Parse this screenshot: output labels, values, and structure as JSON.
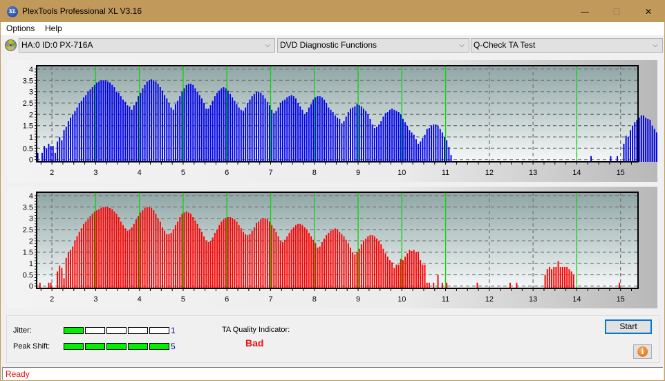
{
  "window": {
    "title": "PlexTools Professional XL V3.16",
    "app_icon_text": "XL"
  },
  "menu": {
    "items": [
      {
        "label": "Options"
      },
      {
        "label": "Help"
      }
    ]
  },
  "toolbar": {
    "drive_select": "HA:0 ID:0  PX-716A",
    "function_select": "DVD Diagnostic Functions",
    "test_select": "Q-Check TA Test"
  },
  "icons": {
    "minimize": "—",
    "maximize": "☐",
    "close": "✕",
    "chevron": "⌵",
    "info": "i"
  },
  "colors": {
    "title_bar": "#c19a5b",
    "top_series": "#0000ee",
    "bottom_series": "#ff0000",
    "marker_lines": "#00dd00",
    "meter_on": "#00ee00",
    "bad": "#ee1111",
    "meter_value": "#0000a0"
  },
  "chart_data": [
    {
      "type": "bar",
      "name": "inner-tracks",
      "title": "",
      "xlabel": "",
      "ylabel": "",
      "xlim": [
        1.65,
        15.4
      ],
      "ylim": [
        -0.1,
        4.15
      ],
      "x_ticks": [
        2,
        3,
        4,
        5,
        6,
        7,
        8,
        9,
        10,
        11,
        12,
        13,
        14,
        15
      ],
      "y_ticks": [
        0,
        0.5,
        1,
        1.5,
        2,
        2.5,
        3,
        3.5,
        4
      ],
      "y_tick_labels": [
        "0",
        "0.5",
        "1",
        "1.5",
        "2",
        "2.5",
        "3",
        "3.5",
        "4"
      ],
      "marker_lines_x": [
        3,
        4,
        5,
        6,
        7,
        8,
        9,
        10,
        11,
        14
      ],
      "grid": true,
      "bar_step": 0.05,
      "series": [
        {
          "name": "distribution",
          "color": "#0000ee",
          "start_x": 1.66,
          "values": [
            0.3,
            0,
            0.3,
            0.6,
            0.5,
            0.7,
            0.6,
            0.6,
            0.3,
            0.8,
            1.0,
            0.85,
            1.3,
            1.45,
            1.7,
            1.85,
            2.0,
            2.15,
            2.3,
            2.5,
            2.6,
            2.75,
            2.85,
            3.0,
            3.1,
            3.2,
            3.3,
            3.4,
            3.45,
            3.5,
            3.5,
            3.5,
            3.45,
            3.4,
            3.3,
            3.2,
            3.0,
            2.95,
            2.8,
            2.65,
            2.55,
            2.4,
            2.35,
            2.2,
            2.4,
            2.55,
            2.8,
            2.95,
            3.15,
            3.3,
            3.45,
            3.5,
            3.55,
            3.5,
            3.45,
            3.35,
            3.2,
            3.05,
            2.85,
            2.7,
            2.5,
            2.3,
            2.2,
            2.45,
            2.6,
            2.8,
            3.0,
            3.15,
            3.3,
            3.35,
            3.35,
            3.3,
            3.15,
            3.0,
            2.85,
            2.7,
            2.5,
            2.25,
            2.25,
            2.4,
            2.6,
            2.8,
            2.95,
            3.05,
            3.15,
            3.2,
            3.15,
            3.05,
            2.9,
            2.75,
            2.6,
            2.45,
            2.3,
            2.2,
            2.15,
            2.3,
            2.5,
            2.65,
            2.8,
            2.9,
            3.0,
            3.0,
            2.95,
            2.85,
            2.7,
            2.55,
            2.4,
            2.2,
            2.05,
            2.15,
            2.3,
            2.5,
            2.6,
            2.65,
            2.75,
            2.8,
            2.85,
            2.8,
            2.7,
            2.5,
            2.35,
            2.2,
            2.0,
            2.1,
            2.3,
            2.45,
            2.65,
            2.75,
            2.8,
            2.8,
            2.75,
            2.65,
            2.5,
            2.3,
            2.2,
            2.1,
            1.95,
            1.85,
            1.8,
            1.6,
            1.7,
            1.9,
            2.1,
            2.25,
            2.3,
            2.35,
            2.45,
            2.4,
            2.35,
            2.25,
            2.15,
            2.0,
            1.8,
            1.55,
            1.4,
            1.45,
            1.55,
            1.7,
            1.9,
            2.05,
            2.1,
            2.2,
            2.25,
            2.2,
            2.15,
            2.1,
            2.0,
            1.8,
            1.65,
            1.5,
            1.3,
            1.2,
            1.1,
            0.9,
            0.7,
            0.8,
            0.95,
            1.1,
            1.35,
            1.4,
            1.5,
            1.55,
            1.55,
            1.5,
            1.35,
            1.2,
            1.0,
            0.85,
            0.55,
            0.2,
            0,
            0,
            0,
            0,
            0,
            0,
            0,
            0,
            0,
            0,
            0,
            0,
            0,
            0,
            0,
            0,
            0,
            0,
            0,
            0,
            0,
            0,
            0,
            0,
            0,
            0,
            0,
            0,
            0,
            0,
            0,
            0,
            0,
            0,
            0,
            0,
            0,
            0,
            0,
            0,
            0,
            0,
            0,
            0,
            0,
            0,
            0,
            0,
            0,
            0,
            0,
            0,
            0,
            0,
            0,
            0,
            0,
            0,
            0,
            0,
            0,
            0,
            0,
            0.15,
            0,
            0,
            0,
            0,
            0,
            0,
            0,
            0,
            0.15,
            0,
            0,
            0.15,
            0,
            0,
            0.7,
            1.05,
            1.0,
            1.3,
            1.5,
            1.65,
            1.75,
            1.85,
            1.95,
            1.95,
            1.85,
            1.8,
            1.75,
            1.5,
            1.35,
            1.2,
            1.0,
            0.5
          ]
        }
      ]
    },
    {
      "type": "bar",
      "name": "outer-tracks",
      "title": "",
      "xlabel": "",
      "ylabel": "",
      "xlim": [
        1.65,
        15.4
      ],
      "ylim": [
        -0.1,
        4.15
      ],
      "x_ticks": [
        2,
        3,
        4,
        5,
        6,
        7,
        8,
        9,
        10,
        11,
        12,
        13,
        14,
        15
      ],
      "y_ticks": [
        0,
        0.5,
        1,
        1.5,
        2,
        2.5,
        3,
        3.5,
        4
      ],
      "y_tick_labels": [
        "0",
        "0.5",
        "1",
        "1.5",
        "2",
        "2.5",
        "3",
        "3.5",
        "4"
      ],
      "marker_lines_x": [
        3,
        4,
        5,
        6,
        7,
        8,
        9,
        10,
        11,
        14
      ],
      "grid": true,
      "bar_step": 0.05,
      "series": [
        {
          "name": "distribution",
          "color": "#ff0000",
          "start_x": 1.66,
          "values": [
            0,
            0.15,
            0,
            0,
            0,
            0.15,
            0.15,
            0,
            0,
            0.65,
            0.9,
            0.8,
            0.35,
            1.25,
            1.5,
            1.6,
            1.75,
            2.0,
            2.2,
            2.4,
            2.55,
            2.75,
            2.85,
            2.95,
            3.1,
            3.2,
            3.3,
            3.35,
            3.4,
            3.45,
            3.5,
            3.5,
            3.5,
            3.45,
            3.4,
            3.3,
            3.2,
            3.05,
            2.85,
            2.7,
            2.55,
            2.45,
            2.5,
            2.6,
            2.75,
            2.95,
            3.1,
            3.25,
            3.35,
            3.45,
            3.5,
            3.5,
            3.45,
            3.35,
            3.2,
            3.0,
            2.85,
            2.6,
            2.45,
            2.3,
            2.3,
            2.35,
            2.5,
            2.7,
            2.85,
            3.05,
            3.2,
            3.25,
            3.3,
            3.25,
            3.2,
            3.05,
            2.9,
            2.75,
            2.55,
            2.4,
            2.2,
            2.0,
            1.95,
            2.0,
            2.15,
            2.35,
            2.5,
            2.7,
            2.85,
            2.95,
            3.0,
            3.05,
            3.05,
            3.0,
            2.95,
            2.85,
            2.7,
            2.55,
            2.4,
            2.3,
            2.25,
            2.3,
            2.45,
            2.6,
            2.8,
            2.85,
            2.95,
            3.0,
            3.0,
            2.95,
            2.85,
            2.7,
            2.55,
            2.4,
            2.2,
            2.0,
            1.95,
            2.05,
            2.2,
            2.35,
            2.5,
            2.6,
            2.7,
            2.75,
            2.75,
            2.7,
            2.6,
            2.5,
            2.35,
            2.2,
            2.05,
            1.9,
            1.7,
            1.75,
            1.95,
            2.1,
            2.25,
            2.35,
            2.45,
            2.5,
            2.55,
            2.5,
            2.4,
            2.3,
            2.2,
            2.05,
            1.9,
            1.7,
            1.5,
            1.4,
            1.5,
            1.65,
            1.85,
            2.0,
            2.1,
            2.2,
            2.25,
            2.25,
            2.2,
            2.1,
            2.0,
            1.85,
            1.65,
            1.45,
            1.3,
            1.15,
            1.05,
            0.8,
            0.95,
            0.95,
            1.2,
            1.15,
            1.3,
            1.45,
            1.6,
            1.55,
            1.6,
            1.5,
            1.5,
            1.15,
            0.95,
            0.95,
            0.15,
            0.15,
            0,
            0.15,
            0,
            0.5,
            0,
            0.15,
            0,
            0.15,
            0,
            0,
            0,
            0,
            0,
            0,
            0,
            0,
            0,
            0,
            0,
            0,
            0,
            0.15,
            0,
            0,
            0,
            0,
            0,
            0,
            0,
            0,
            0,
            0,
            0,
            0,
            0,
            0,
            0.15,
            0,
            0,
            0.15,
            0,
            0,
            0,
            0,
            0,
            0,
            0,
            0,
            0,
            0,
            0,
            0,
            0.5,
            0.75,
            0.85,
            0.75,
            0.85,
            0.85,
            1.1,
            0.85,
            0.85,
            0.85,
            0.85,
            0.75,
            0.65,
            0.5,
            0,
            0,
            0,
            0,
            0,
            0,
            0,
            0,
            0,
            0,
            0,
            0,
            0,
            0,
            0,
            0,
            0,
            0,
            0,
            0,
            0.15
          ]
        }
      ]
    }
  ],
  "results": {
    "jitter_label": "Jitter:",
    "jitter_value": "1",
    "jitter_level": 1,
    "peak_shift_label": "Peak Shift:",
    "peak_shift_value": "5",
    "peak_shift_level": 5,
    "meter_segments": 5,
    "ta_quality_label": "TA Quality Indicator:",
    "ta_quality_value": "Bad"
  },
  "buttons": {
    "start_label": "Start"
  },
  "status": {
    "text": "Ready"
  }
}
